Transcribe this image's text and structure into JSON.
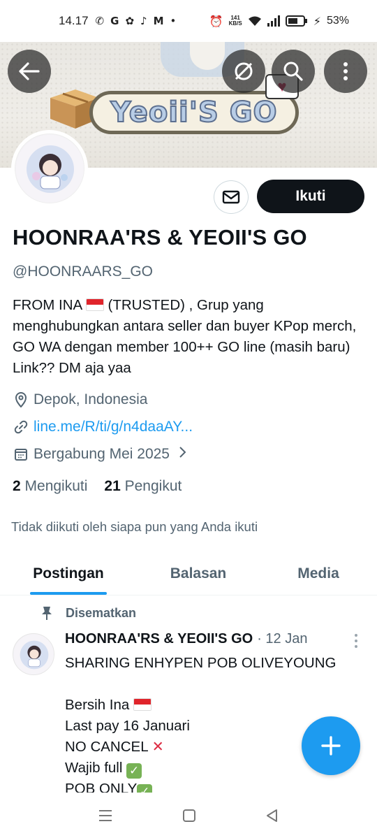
{
  "status_bar": {
    "time": "14.17",
    "icons": [
      "whatsapp-icon",
      "google-icon",
      "clover-icon",
      "tiktok-icon",
      "gmail-icon",
      "dot-icon"
    ],
    "net_speed_value": "141",
    "net_speed_unit": "KB/S",
    "battery": "53%"
  },
  "banner": {
    "logo_text": "Yeoii'S GO"
  },
  "profile": {
    "follow_label": "Ikuti",
    "name": "HOONRAA'RS & YEOII'S GO",
    "handle": "@HOONRAARS_GO",
    "bio_1": "FROM INA",
    "bio_2": "(TRUSTED) ,  Grup yang menghubungkan antara seller dan buyer KPop merch,  GO WA dengan member 100++ GO line (masih baru)  Link?? DM aja yaa",
    "location": "Depok, Indonesia",
    "link": "line.me/R/ti/g/n4daaAY...",
    "joined": "Bergabung Mei 2025",
    "following_count": "2",
    "following_label": "Mengikuti",
    "followers_count": "21",
    "followers_label": "Pengikut",
    "not_followed": "Tidak diikuti oleh siapa pun yang Anda ikuti"
  },
  "tabs": [
    "Postingan",
    "Balasan",
    "Media"
  ],
  "post": {
    "pinned_label": "Disematkan",
    "author": "HOONRAA'RS & YEOII'S GO",
    "date": "· 12 Jan",
    "line1": "SHARING ENHYPEN POB OLIVEYOUNG",
    "line2": "Bersih Ina",
    "line3": "Last pay 16 Januari",
    "line4": "NO CANCEL",
    "line5": "Wajib full",
    "line6": "POB ONLY"
  },
  "colors": {
    "accent": "#1d9bf0",
    "text": "#0f1419",
    "muted": "#536471"
  }
}
